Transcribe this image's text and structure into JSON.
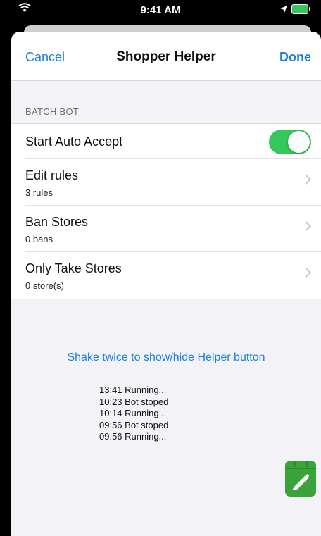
{
  "status_bar": {
    "time": "9:41 AM"
  },
  "navbar": {
    "cancel": "Cancel",
    "title": "Shopper Helper",
    "done": "Done"
  },
  "section": {
    "header": "BATCH BOT"
  },
  "rows": [
    {
      "title": "Start Auto Accept",
      "toggle_on": true
    },
    {
      "title": "Edit rules",
      "subtitle": "3 rules"
    },
    {
      "title": "Ban Stores",
      "subtitle": "0 bans"
    },
    {
      "title": "Only Take Stores",
      "subtitle": "0 store(s)"
    }
  ],
  "shake_hint": "Shake twice to show/hide Helper button",
  "logs": [
    "13:41 Running...",
    "10:23 Bot stoped",
    "10:14 Running...",
    "09:56 Bot stoped",
    "09:56 Running..."
  ],
  "colors": {
    "accent": "#1a7fe0",
    "toggle_on": "#34c759",
    "helper_green": "#3aa33a"
  }
}
